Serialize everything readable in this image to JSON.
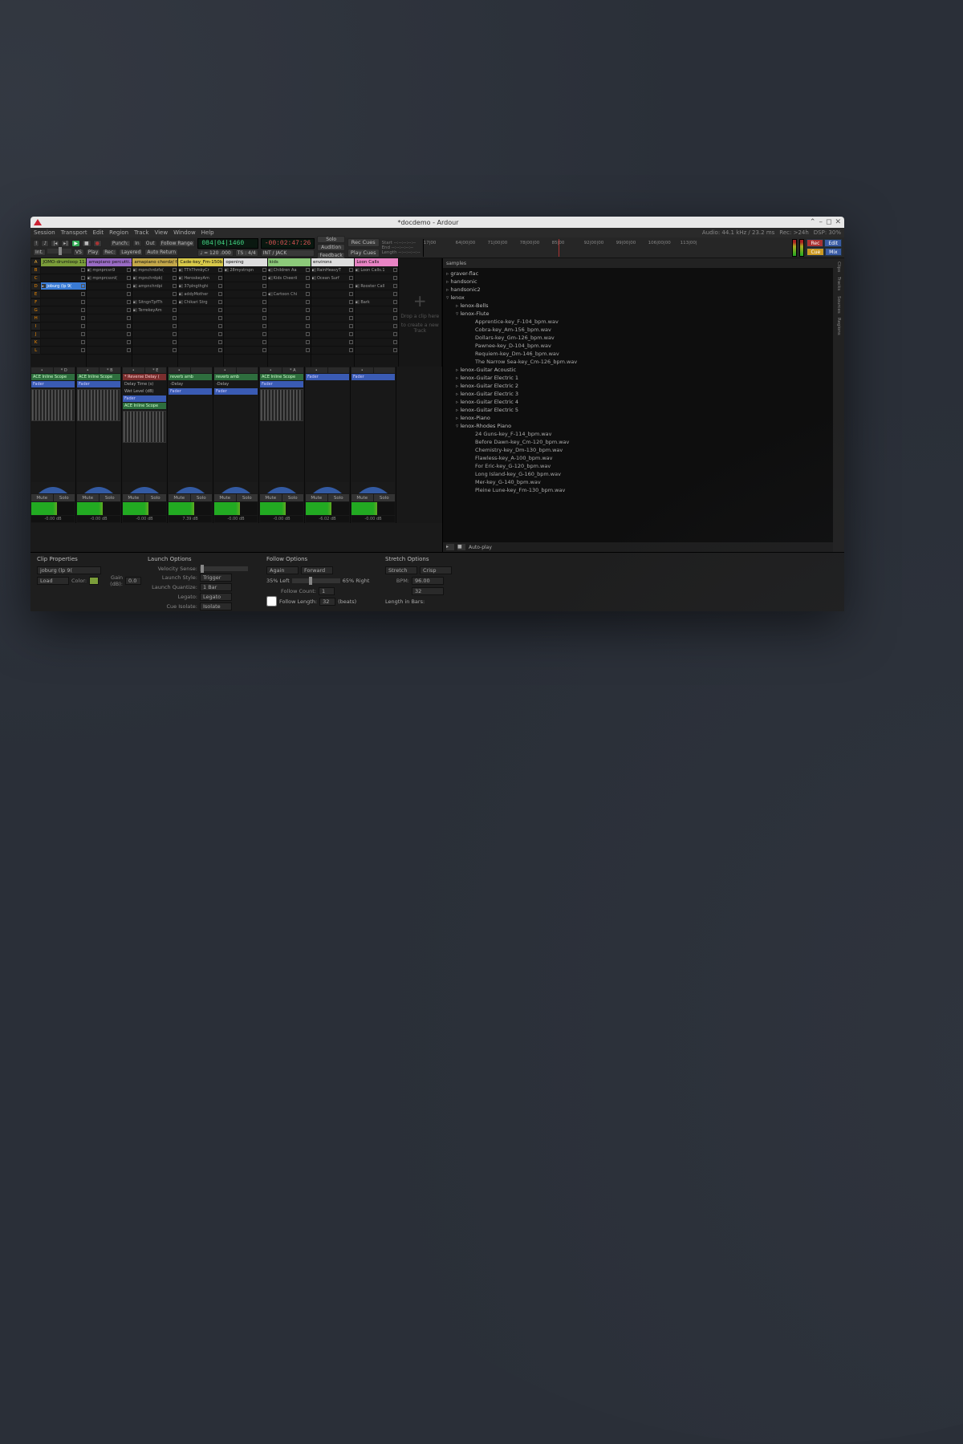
{
  "titlebar": {
    "title": "*docdemo - Ardour"
  },
  "menu": [
    "Session",
    "Transport",
    "Edit",
    "Region",
    "Track",
    "View",
    "Window",
    "Help"
  ],
  "status": {
    "audio": "Audio: 44.1 kHz / 23.2 ms",
    "rec": "Rec: >24h",
    "dsp": "DSP: 30%"
  },
  "transport": {
    "int": "Int.",
    "vs": "VS",
    "play": "Play",
    "rec": "Rec:",
    "layered": "Layered",
    "punch": "Punch:",
    "in": "In",
    "out": "Out",
    "follow": "Follow Range",
    "autoreturn": "Auto Return",
    "bbt": "084|04|1460",
    "tc": "-00:02:47:26",
    "tempo": "♩ = 120 .000",
    "ts": "TS : 4/4",
    "sync": "INT / JACK",
    "solo": "Solo",
    "audition": "Audition",
    "feedback": "Feedback",
    "reccues": "Rec Cues",
    "playcues": "Play Cues",
    "start": "Start",
    "end": "End",
    "length": "Length",
    "modes": {
      "rec": "Rec",
      "edit": "Edit",
      "cue": "Cue",
      "mix": "Mix"
    }
  },
  "ruler_marks": [
    "17|00",
    "64|00|00",
    "71|00|00",
    "78|00|00",
    "85|00",
    "92|00|00",
    "99|00|00",
    "106|00|00",
    "113|00|"
  ],
  "cues": [
    "A",
    "B",
    "C",
    "D",
    "E",
    "F",
    "G",
    "H",
    "I",
    "J",
    "K",
    "L"
  ],
  "tracks": [
    {
      "name": "JOMO-drumloop 11…",
      "color": "c0",
      "slots": [
        "",
        "",
        "joburg (lp 9(",
        "",
        "",
        "",
        "",
        "",
        "",
        "",
        ""
      ],
      "db": "-0.00 dB",
      "out": "* D"
    },
    {
      "name": "amapiano percutti…",
      "color": "c1",
      "slots": [
        "mpnprcsn9",
        "mpnprcssnl(",
        "",
        "",
        "",
        "",
        "",
        "",
        "",
        "",
        ""
      ],
      "db": "-0.00 dB",
      "out": "* B"
    },
    {
      "name": "amapiano chordz/ fx",
      "color": "c2",
      "slots": [
        "mpnchrdzfx(",
        "mpnchrdpk(",
        "ampnchrdpi",
        "",
        "SitngnTpfTh",
        "TerrekeyAm",
        "",
        "",
        "",
        "",
        ""
      ],
      "db": "-0.00 dB",
      "out": "* E"
    },
    {
      "name": "Cade-key_Fm-150b…",
      "color": "c3",
      "slots": [
        "TThThmkyCr",
        "HeroskeyAm",
        "37plngthghi",
        "addyMother",
        "Chikari Strg",
        "",
        "",
        "",
        "",
        "",
        ""
      ],
      "db": "7.39 dB",
      "out": ""
    },
    {
      "name": "opening",
      "color": "c4",
      "slots": [
        "28mystrspn",
        "",
        "",
        "",
        "",
        "",
        "",
        "",
        "",
        "",
        ""
      ],
      "db": "-0.00 dB",
      "out": ""
    },
    {
      "name": "kids",
      "color": "c5",
      "slots": [
        "Children Aa",
        "Kids Cheerii",
        "",
        "Cartoon Chi",
        "",
        "",
        "",
        "",
        "",
        "",
        ""
      ],
      "db": "-0.00 dB",
      "out": "* A"
    },
    {
      "name": "environs",
      "color": "c6",
      "slots": [
        "RainHeavyT",
        "Ocean Surf",
        "",
        "",
        "",
        "",
        "",
        "",
        "",
        "",
        ""
      ],
      "db": "-6.02 dB",
      "out": ""
    },
    {
      "name": "Loon Calls",
      "color": "c7",
      "slots": [
        "Loon Calls.1",
        "",
        "Rooster Call",
        "",
        "Bark",
        "",
        "",
        "",
        "",
        "",
        ""
      ],
      "db": "-0.00 dB",
      "out": ""
    }
  ],
  "plugins": [
    [
      "ACE Inline Scope",
      "",
      "Fader"
    ],
    [
      "ACE Inline Scope",
      "",
      "Fader"
    ],
    [
      "* Reverse Delay (",
      "Delay Time (s)",
      "Wet Level (dB)",
      "Fader",
      "ACE Inline Scope"
    ],
    [
      "reverb amb",
      "-Delay",
      "Fader"
    ],
    [
      "reverb amb",
      "-Delay",
      "Fader"
    ],
    [
      "ACE Inline Scope",
      "",
      "Fader"
    ],
    [
      "Fader"
    ],
    [
      "Fader"
    ]
  ],
  "dropzone": {
    "line1": "Drop a clip here",
    "line2": "to create a new Track"
  },
  "browser": {
    "header": "samples",
    "root": [
      {
        "t": "n",
        "l": "graver-flac"
      },
      {
        "t": "n",
        "l": "handsonic"
      },
      {
        "t": "n",
        "l": "handsonic2"
      },
      {
        "t": "no",
        "l": "lenox",
        "c": [
          {
            "t": "n",
            "l": "lenox-Bells"
          },
          {
            "t": "no",
            "l": "lenox-Flute",
            "c": [
              {
                "t": "f",
                "l": "Apprentice-key_F-104_bpm.wav"
              },
              {
                "t": "f",
                "l": "Cobra-key_Am-156_bpm.wav"
              },
              {
                "t": "f",
                "l": "Dollars-key_Gm-126_bpm.wav"
              },
              {
                "t": "f",
                "l": "Pawnee-key_D-104_bpm.wav"
              },
              {
                "t": "f",
                "l": "Requiem-key_Dm-146_bpm.wav"
              },
              {
                "t": "f",
                "l": "The Narrow Sea-key_Cm-126_bpm.wav"
              }
            ]
          },
          {
            "t": "n",
            "l": "lenox-Guitar Acoustic"
          },
          {
            "t": "n",
            "l": "lenox-Guitar Electric 1"
          },
          {
            "t": "n",
            "l": "lenox-Guitar Electric 2"
          },
          {
            "t": "n",
            "l": "lenox-Guitar Electric 3"
          },
          {
            "t": "n",
            "l": "lenox-Guitar Electric 4"
          },
          {
            "t": "n",
            "l": "lenox-Guitar Electric 5"
          },
          {
            "t": "n",
            "l": "lenox-Piano"
          },
          {
            "t": "no",
            "l": "lenox-Rhodes Piano",
            "c": [
              {
                "t": "f",
                "l": "24 Guns-key_F-114_bpm.wav"
              },
              {
                "t": "f",
                "l": "Before Dawn-key_Cm-120_bpm.wav"
              },
              {
                "t": "f",
                "l": "Chemistry-key_Dm-130_bpm.wav"
              },
              {
                "t": "f",
                "l": "Flawless-key_A-100_bpm.wav"
              },
              {
                "t": "f",
                "l": "For Eric-key_G-120_bpm.wav"
              },
              {
                "t": "f",
                "l": "Long Island-key_G-160_bpm.wav"
              },
              {
                "t": "f",
                "l": "Mer-key_G-140_bpm.wav"
              },
              {
                "t": "f",
                "l": "Pleine Lune-key_Fm-130_bpm.wav"
              }
            ]
          }
        ]
      }
    ],
    "autoplay": "Auto-play"
  },
  "sidetabs": [
    "Clips",
    "Tracks",
    "Sources",
    "Regions"
  ],
  "bottom": {
    "clip": {
      "h": "Clip Properties",
      "name": "joburg (lp 9(",
      "load": "Load",
      "color": "Color:",
      "gain": "Gain (dB):",
      "gainv": "0.0"
    },
    "launch": {
      "h": "Launch Options",
      "vel": "Velocity Sense:",
      "style": "Launch Style:",
      "stylev": "Trigger",
      "quant": "Launch Quantize:",
      "quantv": "1 Bar",
      "legato": "Legato:",
      "legatov": "Legato",
      "cue": "Cue Isolate:",
      "cuev": "Isolate"
    },
    "follow": {
      "h": "Follow Options",
      "again": "Again",
      "forward": "Forward",
      "left": "35% Left",
      "right": "65% Right",
      "count": "Follow Count:",
      "countv": "1",
      "len": "Follow Length:",
      "lenv": "32",
      "beats": "(beats)"
    },
    "stretch": {
      "h": "Stretch Options",
      "stretch": "Stretch",
      "crisp": "Crisp",
      "bpm": "96.00",
      "bars": "32",
      "lenbars": "Length in Bars:"
    }
  }
}
